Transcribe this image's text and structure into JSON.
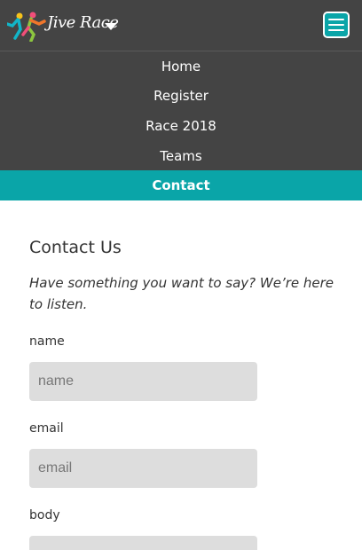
{
  "header": {
    "brand": "Jive Race",
    "logo_icon": "running-people-logo",
    "dropdown_icon": "caret-down-icon",
    "menu_icon": "hamburger-menu-icon",
    "accent_color": "#0aa5a8",
    "bar_color": "#444444"
  },
  "nav": {
    "items": [
      {
        "label": "Home"
      },
      {
        "label": "Register"
      },
      {
        "label": "Race 2018"
      },
      {
        "label": "Teams"
      },
      {
        "label": "Contact"
      }
    ],
    "active": "Contact"
  },
  "contact": {
    "title": "Contact Us",
    "intro": "Have something you want to say? We’re here to listen.",
    "fields": {
      "name": {
        "label": "name",
        "placeholder": "name"
      },
      "email": {
        "label": "email",
        "placeholder": "email"
      },
      "body": {
        "label": "body"
      }
    }
  }
}
